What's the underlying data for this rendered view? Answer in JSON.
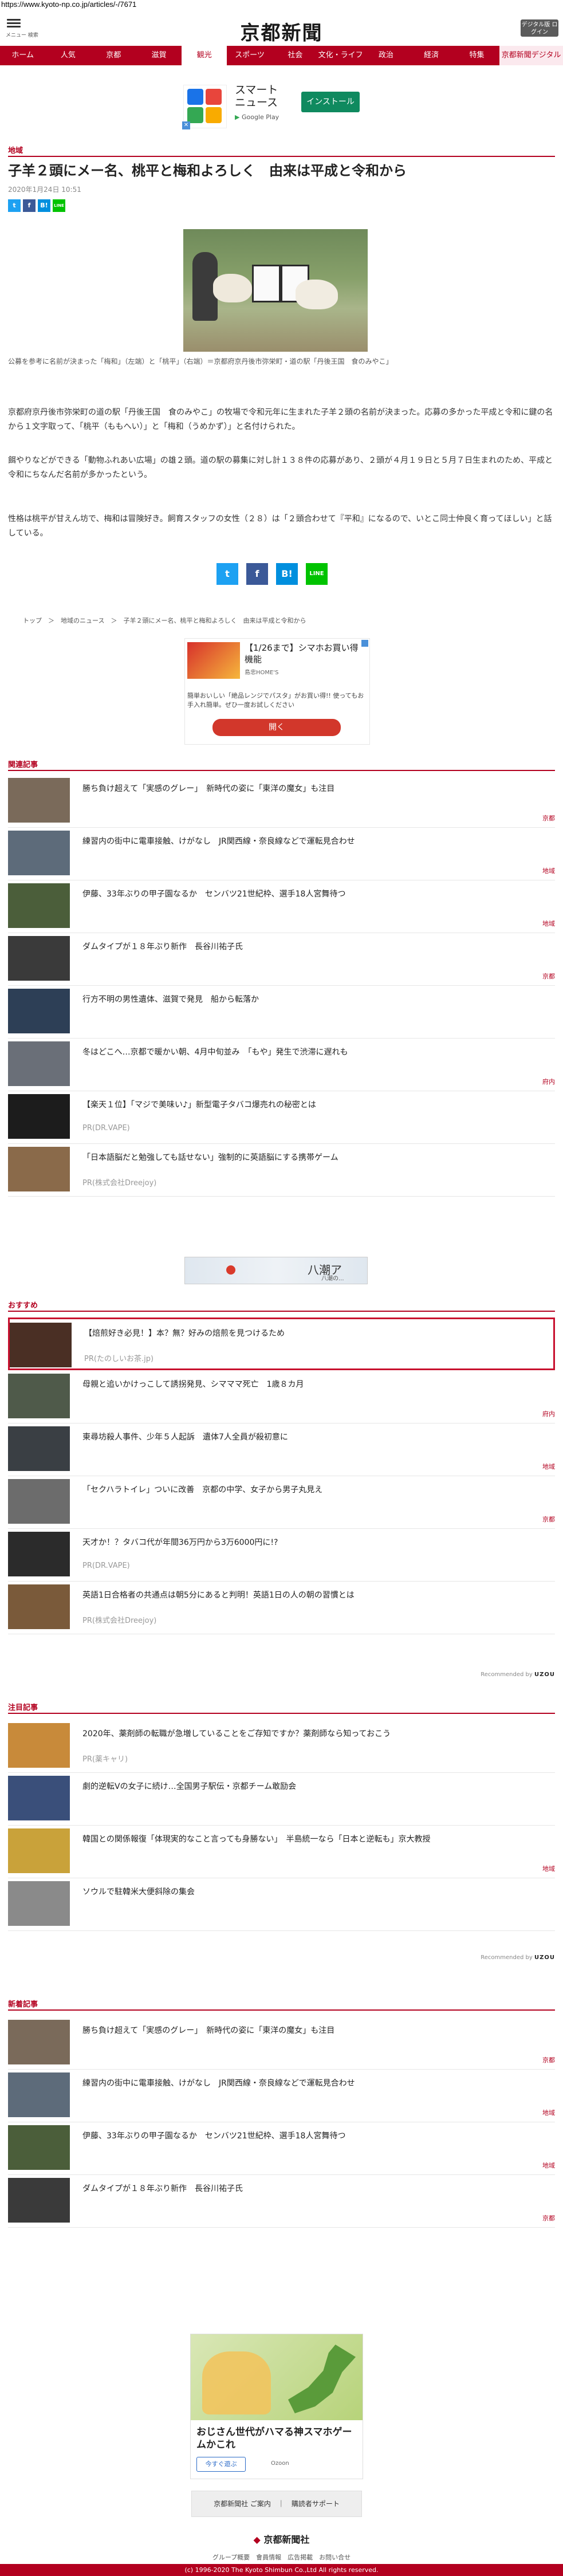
{
  "url": "https://www.kyoto-np.co.jp/articles/-/7671",
  "header": {
    "menu_label": "メニュー",
    "search_label": "検索",
    "logo": "京都新聞",
    "digital_button": "デジタル版 ログイン"
  },
  "nav": [
    "ホーム",
    "人気",
    "京都",
    "滋賀",
    "観光",
    "スポーツ",
    "社会",
    "文化・ライフ",
    "政治",
    "経済",
    "特集",
    "京都新聞デジタル"
  ],
  "app_banner": {
    "name_line1": "スマート",
    "name_line2": "ニュース",
    "store": "Google Play",
    "install": "インストール"
  },
  "article": {
    "section": "地域",
    "headline": "子羊２頭にメー名、桃平と梅和よろしく　由来は平成と令和から",
    "date": "2020年1月24日 10:51",
    "caption": "公募を参考に名前が決まった「梅和」（左端）と「桃平」（右端）＝京都府京丹後市弥栄町・道の駅「丹後王国　食のみやこ」",
    "paragraphs": [
      "京都府京丹後市弥栄町の道の駅「丹後王国　食のみやこ」の牧場で令和元年に生まれた子羊２頭の名前が決まった。応募の多かった平成と令和に鍵の名から１文字取って、「桃平（ももへい）」と「梅和（うめかず）」と名付けられた。",
      "餌やりなどができる「動物ふれあい広場」の雄２頭。道の駅の募集に対し計１３８件の応募があり、２頭が４月１９日と５月７日生まれのため、平成と令和にちなんだ名前が多かったという。",
      "性格は桃平が甘えん坊で、梅和は冒険好き。飼育スタッフの女性（２８）は「２頭合わせて『平和』になるので、いとこ同士仲良く育ってほしい」と話している。"
    ]
  },
  "share": {
    "twitter": "t",
    "facebook": "f",
    "hatena": "B!",
    "line": "LINE"
  },
  "breadcrumb": "トップ　＞　地域のニュース　＞　子羊２頭にメー名、桃平と梅和よろしく　由来は平成と令和から",
  "ad2": {
    "title": "【1/26まで】シマホお買い得機能",
    "brand": "島忠HOME'S",
    "body": "簡単おいしい「絶品レンジでパスタ」がお買い得!! 使ってもお手入れ簡単。ぜひ一度お試しください",
    "button": "開く"
  },
  "related": {
    "label": "関連記事",
    "items": [
      {
        "title": "勝ち負け超えて「実感のグレー」　新時代の姿に「東洋の魔女」も注目",
        "cat": "京都",
        "color": "#7a6a5a"
      },
      {
        "title": "練習内の街中に電車接触、けがなし　JR関西線・奈良線などで運転見合わせ",
        "cat": "地域",
        "color": "#5d6b7a"
      },
      {
        "title": "伊藤、33年ぶりの甲子園なるか　センバツ21世紀枠、選手18人宮舞待つ",
        "cat": "地域",
        "color": "#4b5e3a"
      },
      {
        "title": "ダムタイプが１８年ぶり新作　長谷川祐子氏",
        "cat": "京都",
        "color": "#3a3a3a"
      },
      {
        "title": "行方不明の男性遺体、滋賀で発見　船から転落か",
        "cat": "",
        "color": "#2d3f56"
      },
      {
        "title": "冬はどこへ…京都で暖かい朝、4月中旬並み　「もや」発生で渋滞に遅れも",
        "cat": "府内",
        "color": "#6a6f78"
      },
      {
        "title": "【楽天１位】「マジで美味い♪」新型電子タバコ爆売れの秘密とは",
        "cat": "PR(DR.VAPE)",
        "color": "#1c1c1c",
        "pr": true
      },
      {
        "title": "「日本語脳だと勉強しても話せない」強制的に英語脳にする携帯ゲーム",
        "cat": "PR(株式会社Dreejoy)",
        "color": "#8a6a4a",
        "pr": true
      }
    ]
  },
  "map_ad": {
    "label": "八潮ア",
    "sub": "八潮の..."
  },
  "recommend": {
    "label": "おすすめ",
    "items": [
      {
        "title": "【焙煎好き必見！】本？無？好みの焙煎を見つけるため",
        "cat": "PR(たのしいお茶.jp)",
        "color": "#4a2f24",
        "pr": true,
        "hl": true
      },
      {
        "title": "母親と追いかけっこして誘拐発見、シマママ死亡　1歳８カ月",
        "cat": "府内",
        "color": "#4f5a4a"
      },
      {
        "title": "東尋坊殺人事件、少年５人起訴　遺体7人全員が殺初意に",
        "cat": "地域",
        "color": "#3a3f44"
      },
      {
        "title": "「セクハラトイレ」ついに改善　京都の中学、女子から男子丸見え",
        "cat": "京都",
        "color": "#6c6c6c"
      },
      {
        "title": "天才か！？タバコ代が年間36万円から3万6000円に!?",
        "cat": "PR(DR.VAPE)",
        "color": "#2b2b2b",
        "pr": true
      },
      {
        "title": "英語1日合格者の共通点は朝5分にあると判明！英語1日の人の朝の習慣とは",
        "cat": "PR(株式会社Dreejoy)",
        "color": "#7a5a3a",
        "pr": true
      }
    ]
  },
  "attention": {
    "label": "注目記事",
    "items": [
      {
        "title": "2020年、薬剤師の転職が急増していることをご存知ですか？薬剤師なら知っておこう",
        "cat": "PR(薬キャリ)",
        "color": "#c88a3a",
        "pr": true
      },
      {
        "title": "劇的逆転Vの女子に続け…全国男子駅伝・京都チーム敢励会",
        "cat": "",
        "color": "#3a4f7a"
      },
      {
        "title": "韓国との関係報復「体現実的なこと言っても身勝ない」　半島統一なら「日本と逆転も」京大教授",
        "cat": "地域",
        "color": "#c9a23a"
      },
      {
        "title": "ソウルで駐韓米大便斜除の集会",
        "cat": "",
        "color": "#8a8a8a"
      }
    ]
  },
  "latest": {
    "label": "新着記事",
    "items": [
      {
        "title": "勝ち負け超えて「実感のグレー」　新時代の姿に「東洋の魔女」も注目",
        "cat": "京都",
        "color": "#7a6a5a"
      },
      {
        "title": "練習内の街中に電車接触、けがなし　JR関西線・奈良線などで運転見合わせ",
        "cat": "地域",
        "color": "#5d6b7a"
      },
      {
        "title": "伊藤、33年ぶりの甲子園なるか　センバツ21世紀枠、選手18人宮舞待つ",
        "cat": "地域",
        "color": "#4b5e3a"
      },
      {
        "title": "ダムタイプが１８年ぶり新作　長谷川祐子氏",
        "cat": "京都",
        "color": "#3a3a3a"
      }
    ]
  },
  "recommended_by": "Recommended by",
  "recommended_brand": "UZOU",
  "game_ad": {
    "title": "おじさん世代がハマる神スマホゲームかこれ",
    "button": "今すぐ遊ぶ",
    "brand": "Ozoon"
  },
  "bottom_buttons": "京都新聞社 ご案内　｜　購読者サポート",
  "bottom_logo": "京都新聞社",
  "footer_links": "グループ概要　會員情報　広告掲載　お問い合せ",
  "copyright": "(c) 1996-2020 The Kyoto Shimbun Co.,Ltd All rights reserved."
}
